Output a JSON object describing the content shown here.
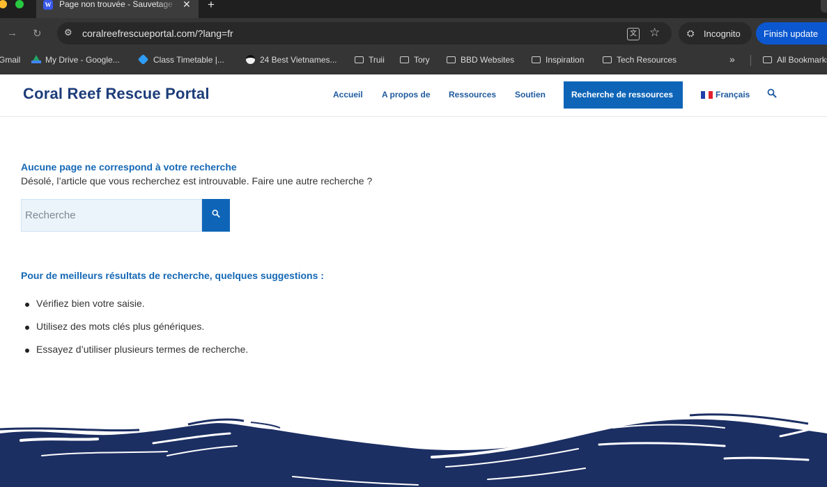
{
  "browser": {
    "tab_title": "Page non trouvée - Sauvetage",
    "tab_favicon": "W",
    "url": "coralreefrescueportal.com/?lang=fr",
    "incognito_label": "Incognito",
    "update_button": "Finish update",
    "bookmarks": [
      {
        "label": "Gmail",
        "icon": "gmail"
      },
      {
        "label": "My Drive - Google...",
        "icon": "drive-icon"
      },
      {
        "label": "Class Timetable |...",
        "icon": "gem-icon"
      },
      {
        "label": "24 Best Vietnames...",
        "icon": "face-icon"
      },
      {
        "label": "Truii",
        "icon": "folder-icon"
      },
      {
        "label": "Tory",
        "icon": "folder-icon"
      },
      {
        "label": "BBD Websites",
        "icon": "folder-icon"
      },
      {
        "label": "Inspiration",
        "icon": "folder-icon"
      },
      {
        "label": "Tech Resources",
        "icon": "folder-icon"
      },
      {
        "label": "All Bookmarks",
        "icon": "folder-icon"
      }
    ],
    "more_glyph": "»"
  },
  "site": {
    "brand": "Coral Reef Rescue Portal",
    "nav": [
      "Accueil",
      "A propos de",
      "Ressources",
      "Soutien"
    ],
    "nav_cta": "Recherche de ressources",
    "language": "Français"
  },
  "main": {
    "not_found_heading": "Aucune page ne correspond à votre recherche",
    "not_found_text": "Désolé, l’article que vous recherchez est introuvable. Faire une autre recherche ?",
    "search_placeholder": "Recherche",
    "suggestions_heading": "Pour de meilleurs résultats de recherche, quelques suggestions :",
    "suggestions": [
      "Vérifiez bien votre saisie.",
      "Utilisez des mots clés plus génériques.",
      "Essayez d’utiliser plusieurs termes de recherche."
    ]
  },
  "colors": {
    "brand_navy": "#1d3d7a",
    "accent_blue": "#0e65b8",
    "wave_navy": "#1c2f63"
  }
}
